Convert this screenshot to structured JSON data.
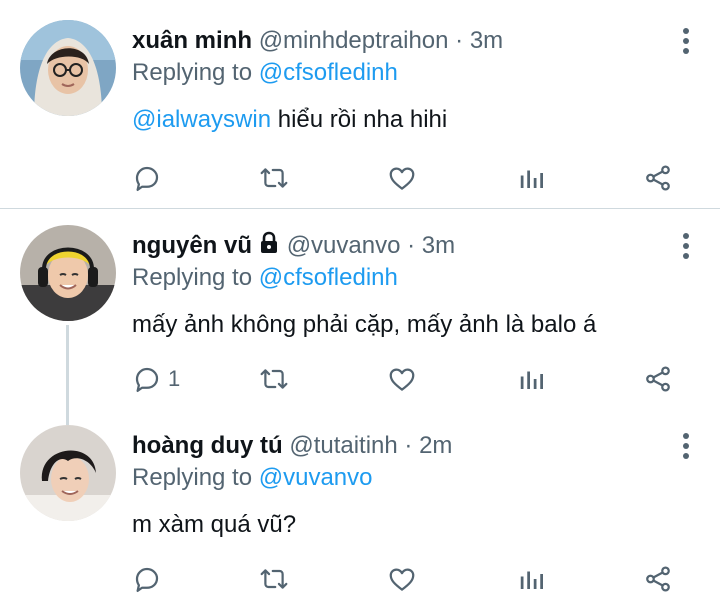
{
  "replies": [
    {
      "name": "xuân minh",
      "handle": "@minhdeptraihon",
      "time": "3m",
      "replying_prefix": "Replying to",
      "replying_to": "@cfsofledinh",
      "body_mention": "@ialwayswin",
      "body_text": " hiểu rồi nha hihi",
      "reply_count": ""
    },
    {
      "name": "nguyên vũ",
      "handle": "@vuvanvo",
      "time": "3m",
      "locked": true,
      "replying_prefix": "Replying to",
      "replying_to": "@cfsofledinh",
      "body_text": "mấy ảnh không phải cặp, mấy ảnh là balo á",
      "reply_count": "1"
    },
    {
      "name": "hoàng duy tú",
      "handle": "@tutaitinh",
      "time": "2m",
      "replying_prefix": "Replying to",
      "replying_to": "@vuvanvo",
      "body_text": "m xàm quá vũ?",
      "reply_count": ""
    }
  ],
  "separator": " · ",
  "icons": [
    "reply-icon",
    "retweet-icon",
    "like-icon",
    "analytics-icon",
    "share-icon",
    "more-icon",
    "lock-icon"
  ],
  "colors": {
    "link": "#1d9bf0",
    "secondary": "#536471",
    "divider": "#cfd9de"
  }
}
